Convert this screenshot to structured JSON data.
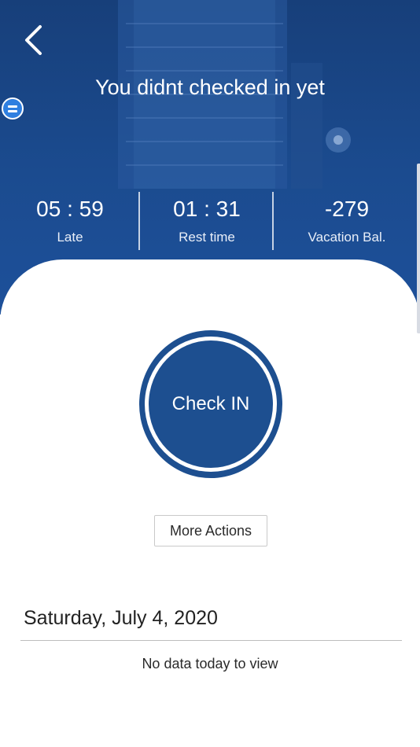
{
  "header": {
    "title": "You didnt checked in yet",
    "accent_color": "#1d4f90"
  },
  "stats": [
    {
      "value": "05 : 59",
      "label": "Late"
    },
    {
      "value": "01 : 31",
      "label": "Rest time"
    },
    {
      "value": "-279",
      "label": "Vacation Bal."
    }
  ],
  "check_in": {
    "label": "Check IN"
  },
  "more_actions": {
    "label": "More Actions"
  },
  "day": {
    "date": "Saturday, July 4, 2020",
    "empty_message": "No data today to view"
  },
  "icons": {
    "back": "chevron-left-icon",
    "side_tab": "menu-lines-icon"
  }
}
